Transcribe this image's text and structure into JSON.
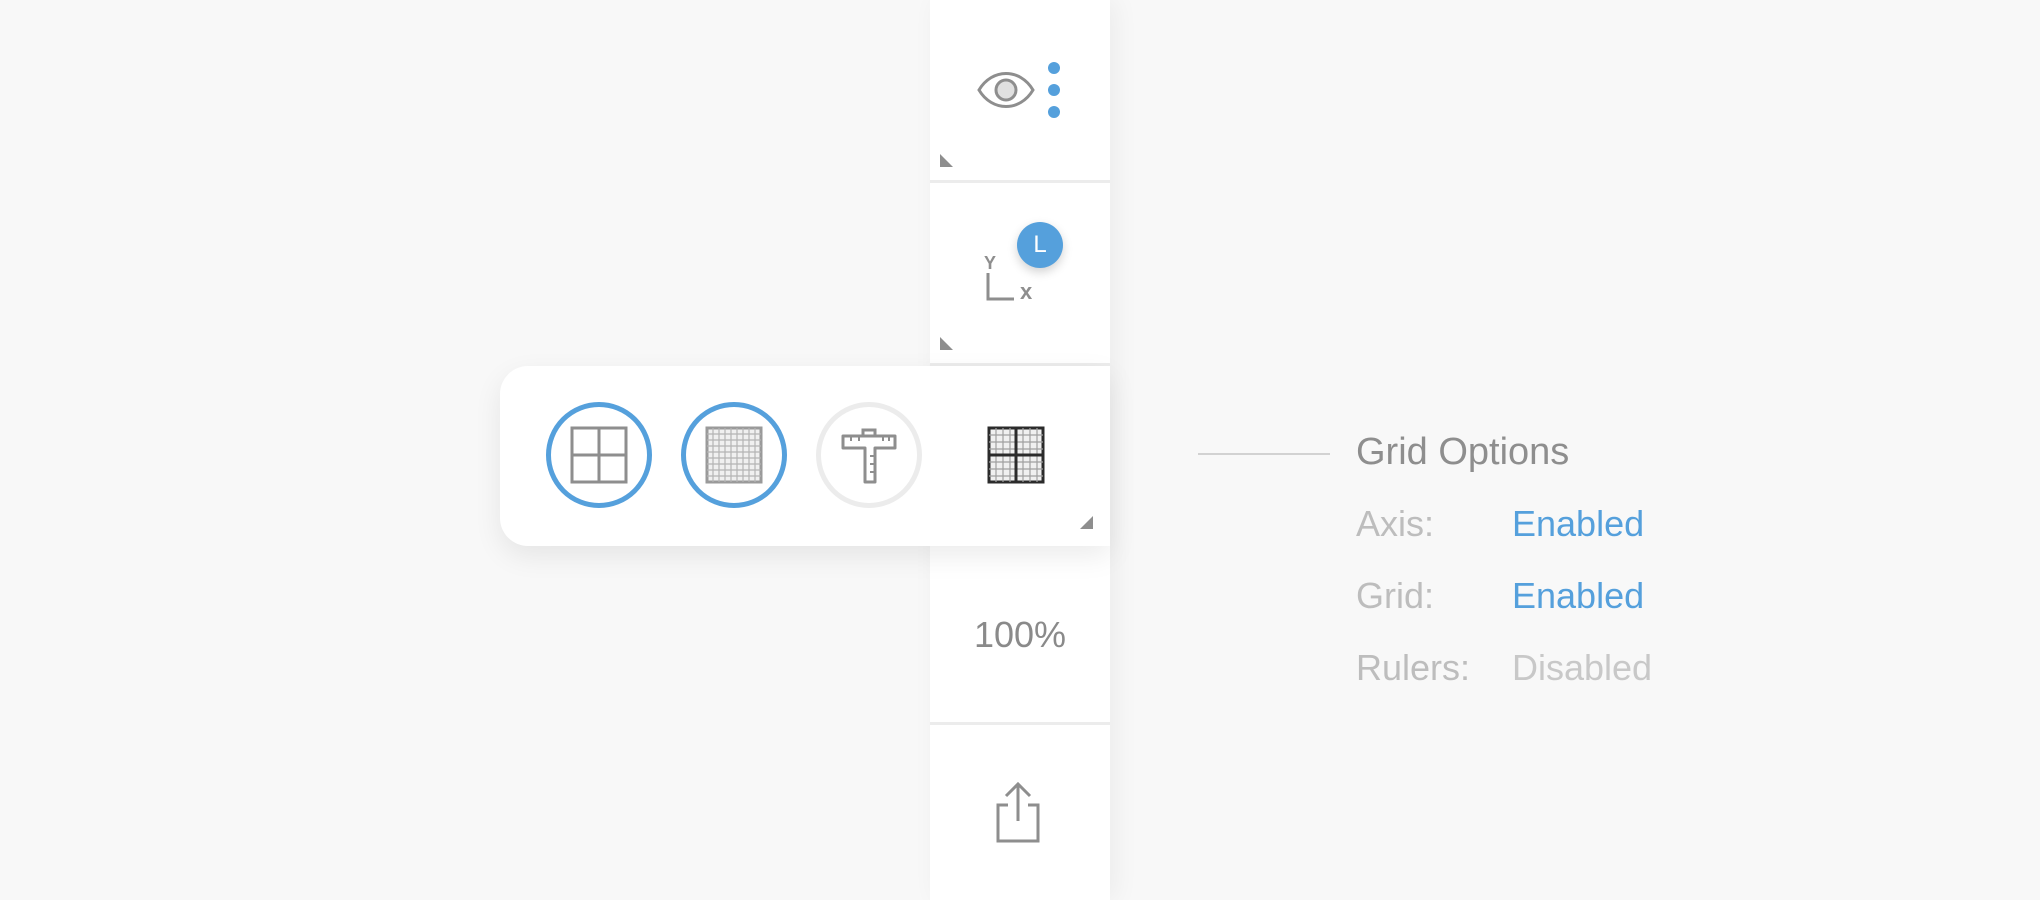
{
  "toolbar": {
    "visibility": {
      "icon": "eye-icon",
      "menu_icon": "kebab-menu-icon"
    },
    "axis": {
      "y_label": "Y",
      "x_label": "x",
      "badge": "L"
    },
    "zoom": {
      "value": "100%"
    },
    "share": {
      "icon": "share-icon"
    }
  },
  "grid_popup": {
    "options": [
      {
        "name": "axis-option",
        "icon": "axis-quadrants-icon",
        "selected": true
      },
      {
        "name": "grid-option",
        "icon": "fine-grid-icon",
        "selected": true
      },
      {
        "name": "rulers-option",
        "icon": "ruler-icon",
        "selected": false
      },
      {
        "name": "combined-option",
        "icon": "grid-combined-icon"
      }
    ]
  },
  "callout": {
    "title": "Grid Options",
    "rows": [
      {
        "label": "Axis:",
        "value": "Enabled"
      },
      {
        "label": "Grid:",
        "value": "Enabled"
      },
      {
        "label": "Rulers:",
        "value": "Disabled"
      }
    ]
  },
  "colors": {
    "accent": "#55a0dc",
    "disabled_text": "#c8c8c8",
    "icon_gray": "#8e8e8e"
  }
}
